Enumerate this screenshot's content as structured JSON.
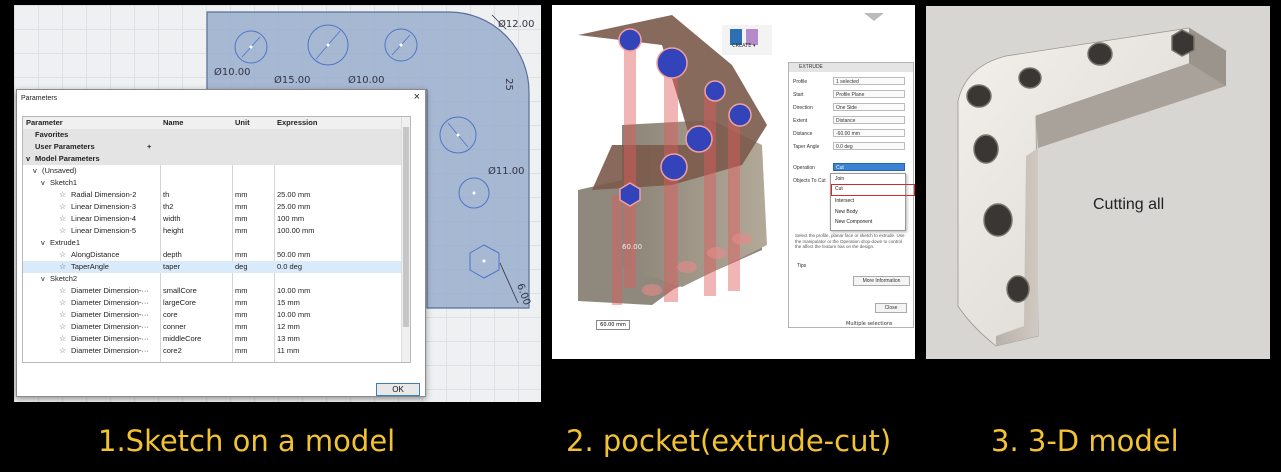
{
  "panel1": {
    "dims": [
      "Ø12.00",
      "Ø10.00",
      "Ø15.00",
      "Ø10.00",
      "25",
      "Ø11.00",
      "6.00"
    ],
    "dialog": {
      "title": "Parameters",
      "close": "×",
      "columns": [
        "Parameter",
        "Name",
        "Unit",
        "Expression"
      ],
      "groups": {
        "favorites": "Favorites",
        "user": "User Parameters",
        "model": "Model Parameters",
        "unsaved": "(Unsaved)",
        "sketch1": "Sketch1",
        "extrude1": "Extrude1",
        "sketch2": "Sketch2"
      },
      "plus": "+",
      "sketch1_rows": [
        {
          "param": "Radial Dimension-2",
          "name": "th",
          "unit": "mm",
          "expr": "25.00 mm"
        },
        {
          "param": "Linear Dimension-3",
          "name": "th2",
          "unit": "mm",
          "expr": "25.00 mm"
        },
        {
          "param": "Linear Dimension-4",
          "name": "width",
          "unit": "mm",
          "expr": "100 mm"
        },
        {
          "param": "Linear Dimension-5",
          "name": "height",
          "unit": "mm",
          "expr": "100.00 mm"
        }
      ],
      "extrude1_rows": [
        {
          "param": "AlongDistance",
          "name": "depth",
          "unit": "mm",
          "expr": "50.00 mm"
        },
        {
          "param": "TaperAngle",
          "name": "taper",
          "unit": "deg",
          "expr": "0.0 deg"
        }
      ],
      "sketch2_rows": [
        {
          "param": "Diameter Dimension-···",
          "name": "smallCore",
          "unit": "mm",
          "expr": "10.00 mm"
        },
        {
          "param": "Diameter Dimension-···",
          "name": "largeCore",
          "unit": "mm",
          "expr": "15 mm"
        },
        {
          "param": "Diameter Dimension-···",
          "name": "core",
          "unit": "mm",
          "expr": "10.00 mm"
        },
        {
          "param": "Diameter Dimension-···",
          "name": "conner",
          "unit": "mm",
          "expr": "12 mm"
        },
        {
          "param": "Diameter Dimension-···",
          "name": "middleCore",
          "unit": "mm",
          "expr": "13 mm"
        },
        {
          "param": "Diameter Dimension-···",
          "name": "core2",
          "unit": "mm",
          "expr": "11 mm"
        }
      ],
      "ok": "OK"
    }
  },
  "panel2": {
    "toolbar_label": "CREATE ▾",
    "panel_title": "EXTRUDE",
    "fields": [
      {
        "label": "Profile",
        "value": "1 selected"
      },
      {
        "label": "Start",
        "value": "Profile Plane"
      },
      {
        "label": "Direction",
        "value": "One Side"
      },
      {
        "label": "Extent",
        "value": "Distance"
      },
      {
        "label": "Distance",
        "value": "-60.00 mm"
      },
      {
        "label": "Taper Angle",
        "value": "0.0 deg"
      }
    ],
    "operation_label": "Operation",
    "operation_value": "Cut",
    "objects_label": "Objects To Cut",
    "dropdown": [
      "Join",
      "Cut",
      "Intersect",
      "New Body",
      "New Component"
    ],
    "help_text": "Select the profile, planar face or sketch to extrude. Use the manipulator or the Operation drop-down to control the affect the feature has on the design.",
    "tips_label": "Tips",
    "more_info": "More Information",
    "close": "Close",
    "canvas_value": "60.00",
    "distance_input": "60.00 mm",
    "status": "Multiple selections"
  },
  "panel3": {
    "label": "Cutting all"
  },
  "captions": {
    "c1": "1.Sketch on a model",
    "c2": "2. pocket(extrude-cut)",
    "c3": "3. 3-D model"
  },
  "colors": {
    "caption": "#f2c230",
    "sketch_fill": "#8fa6c8",
    "selected_face": "#3344bb",
    "cut_red": "#e64a4a"
  }
}
